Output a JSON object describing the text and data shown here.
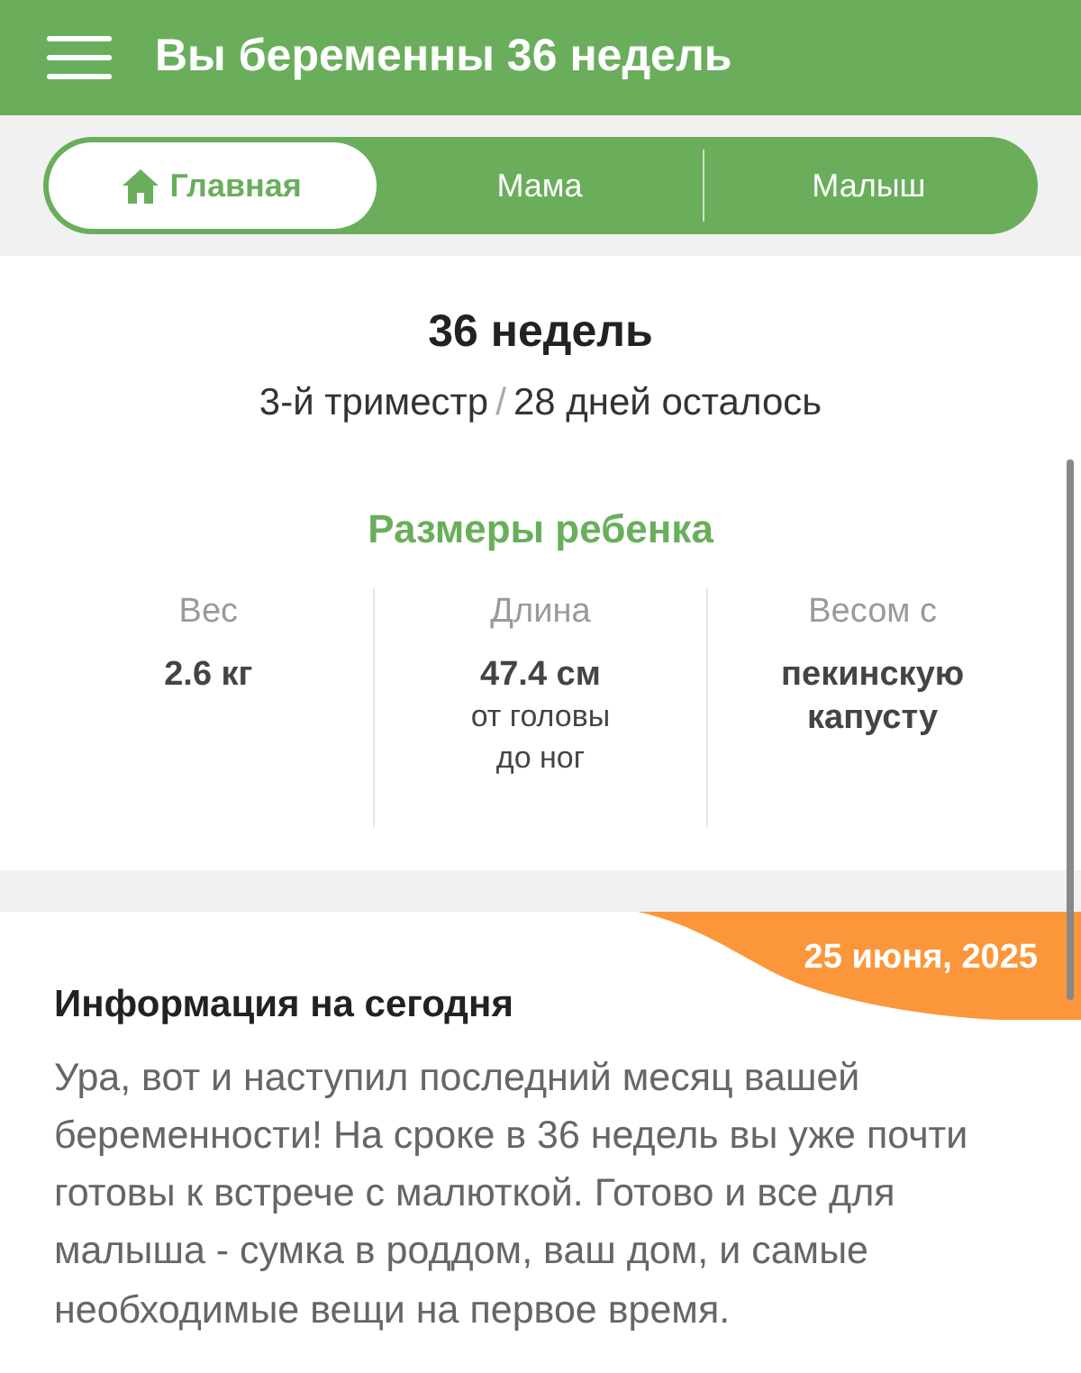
{
  "header": {
    "title": "Вы беременны 36 недель"
  },
  "tabs": [
    {
      "label": "Главная",
      "selected": true
    },
    {
      "label": "Мама",
      "selected": false
    },
    {
      "label": "Малыш",
      "selected": false
    }
  ],
  "summary": {
    "week": "36 недель",
    "trimester": "3-й триместр",
    "separator": "/",
    "remaining": "28 дней осталось"
  },
  "baby_size": {
    "title": "Размеры ребенка",
    "stats": [
      {
        "label": "Вес",
        "value": "2.6 кг"
      },
      {
        "label": "Длина",
        "value": "47.4 см",
        "note": "от головы до ног"
      },
      {
        "label": "Весом с",
        "value": "пекинскую капусту"
      }
    ]
  },
  "today": {
    "date": "25 июня, 2025",
    "title": "Информация на сегодня",
    "text": "Ура, вот и наступил последний месяц вашей беременности! На сроке в 36 недель вы уже почти готовы к встрече с малюткой. Готово и все для малыша - сумка в роддом, ваш дом, и самые необходимые вещи на первое время."
  }
}
